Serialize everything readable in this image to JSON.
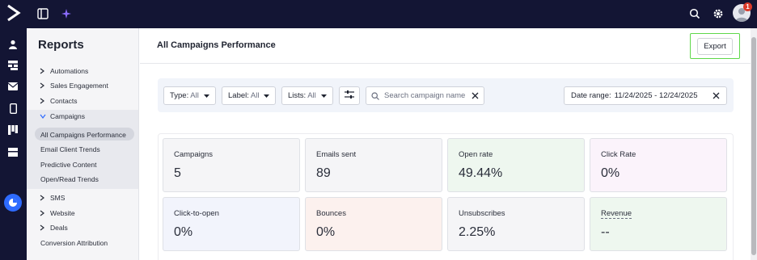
{
  "topbar": {
    "notification_count": "1",
    "icons": [
      "logo-icon",
      "sidebar-toggle-icon",
      "sparkle-icon",
      "search-icon",
      "gear-icon",
      "avatar"
    ]
  },
  "rail": {
    "icons": [
      "contacts-icon",
      "sitemap-icon",
      "mail-icon",
      "mobile-icon",
      "board-icon",
      "list-icon",
      "reports-icon"
    ]
  },
  "sidebar": {
    "title": "Reports",
    "items": [
      {
        "label": "Automations",
        "expanded": false
      },
      {
        "label": "Sales Engagement",
        "expanded": false
      },
      {
        "label": "Contacts",
        "expanded": false
      },
      {
        "label": "Campaigns",
        "expanded": true
      }
    ],
    "campaign_subitems": [
      "All Campaigns Performance",
      "Email Client Trends",
      "Predictive Content",
      "Open/Read Trends"
    ],
    "items_after": [
      {
        "label": "SMS",
        "expanded": false
      },
      {
        "label": "Website",
        "expanded": false
      },
      {
        "label": "Deals",
        "expanded": false
      }
    ],
    "plain_items": [
      "Conversion Attribution"
    ]
  },
  "main": {
    "title": "All Campaigns Performance",
    "export_label": "Export",
    "filters": {
      "type": {
        "label": "Type:",
        "value": "All"
      },
      "label": {
        "label": "Label:",
        "value": "All"
      },
      "lists": {
        "label": "Lists:",
        "value": "All"
      },
      "search_placeholder": "Search campaign name",
      "date_range_label": "Date range:",
      "date_range_value": "11/24/2025 - 12/24/2025"
    },
    "cards": [
      {
        "label": "Campaigns",
        "value": "5",
        "bg": "#f5f5f7"
      },
      {
        "label": "Emails sent",
        "value": "89",
        "bg": "#f5f5f7"
      },
      {
        "label": "Open rate",
        "value": "49.44%",
        "bg": "#eef7ef"
      },
      {
        "label": "Click Rate",
        "value": "0%",
        "bg": "#fbf3fb"
      },
      {
        "label": "Click-to-open",
        "value": "0%",
        "bg": "#f2f4fc"
      },
      {
        "label": "Bounces",
        "value": "0%",
        "bg": "#fcf1ee"
      },
      {
        "label": "Unsubscribes",
        "value": "2.25%",
        "bg": "#f5f5f7"
      },
      {
        "label": "Revenue",
        "value": "--",
        "bg": "#eef7ef"
      }
    ]
  },
  "colors": {
    "topbar": "#131534",
    "accent": "#2e6bff",
    "export_highlight": "#5fd84a",
    "badge": "#d93a2b"
  }
}
